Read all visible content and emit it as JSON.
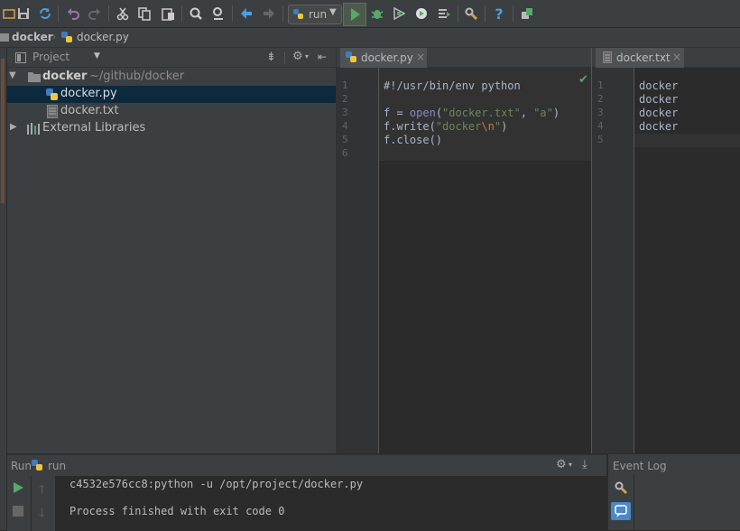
{
  "toolbar": {
    "run_config_label": "run",
    "icons": [
      "open-icon",
      "save-icon",
      "sync-icon",
      "undo-icon",
      "redo-icon",
      "cut-icon",
      "copy-icon",
      "paste-icon",
      "find-icon",
      "replace-icon",
      "back-icon",
      "forward-icon",
      "run-config-icon",
      "run-icon",
      "debug-icon",
      "coverage-icon",
      "profile-icon",
      "concurrency-icon",
      "settings-icon",
      "help-icon",
      "vcs-icon"
    ]
  },
  "breadcrumb": {
    "root": "docker",
    "file": "docker.py"
  },
  "project": {
    "selector_label": "Project",
    "root": {
      "name": "docker",
      "path": "~/github/docker"
    },
    "files": [
      "docker.py",
      "docker.txt"
    ],
    "external": "External Libraries"
  },
  "editor_left": {
    "tab": "docker.py",
    "line_numbers": [
      "1",
      "2",
      "3",
      "4",
      "5",
      "6"
    ],
    "lines": {
      "l1": "#!/usr/bin/env python",
      "l3_a": "f = ",
      "l3_b": "open",
      "l3_c": "(",
      "l3_d": "\"docker.txt\"",
      "l3_e": ", ",
      "l3_f": "\"a\"",
      "l3_g": ")",
      "l4_a": "f.write(",
      "l4_b": "\"docker",
      "l4_c": "\\n",
      "l4_d": "\"",
      "l4_e": ")",
      "l5": "f.close()"
    }
  },
  "editor_right": {
    "tab": "docker.txt",
    "line_numbers": [
      "1",
      "2",
      "3",
      "4",
      "5"
    ],
    "lines": [
      "docker",
      "docker",
      "docker",
      "docker"
    ]
  },
  "run": {
    "title": "Run",
    "config": "run",
    "command": "c4532e576cc8:python -u /opt/project/docker.py",
    "result": "Process finished with exit code 0"
  },
  "event_log": {
    "title": "Event Log"
  },
  "colors": {
    "accent_selection": "#0d293e",
    "keyword": "#8888c6",
    "string": "#6a8759",
    "escape": "#cc7832"
  }
}
